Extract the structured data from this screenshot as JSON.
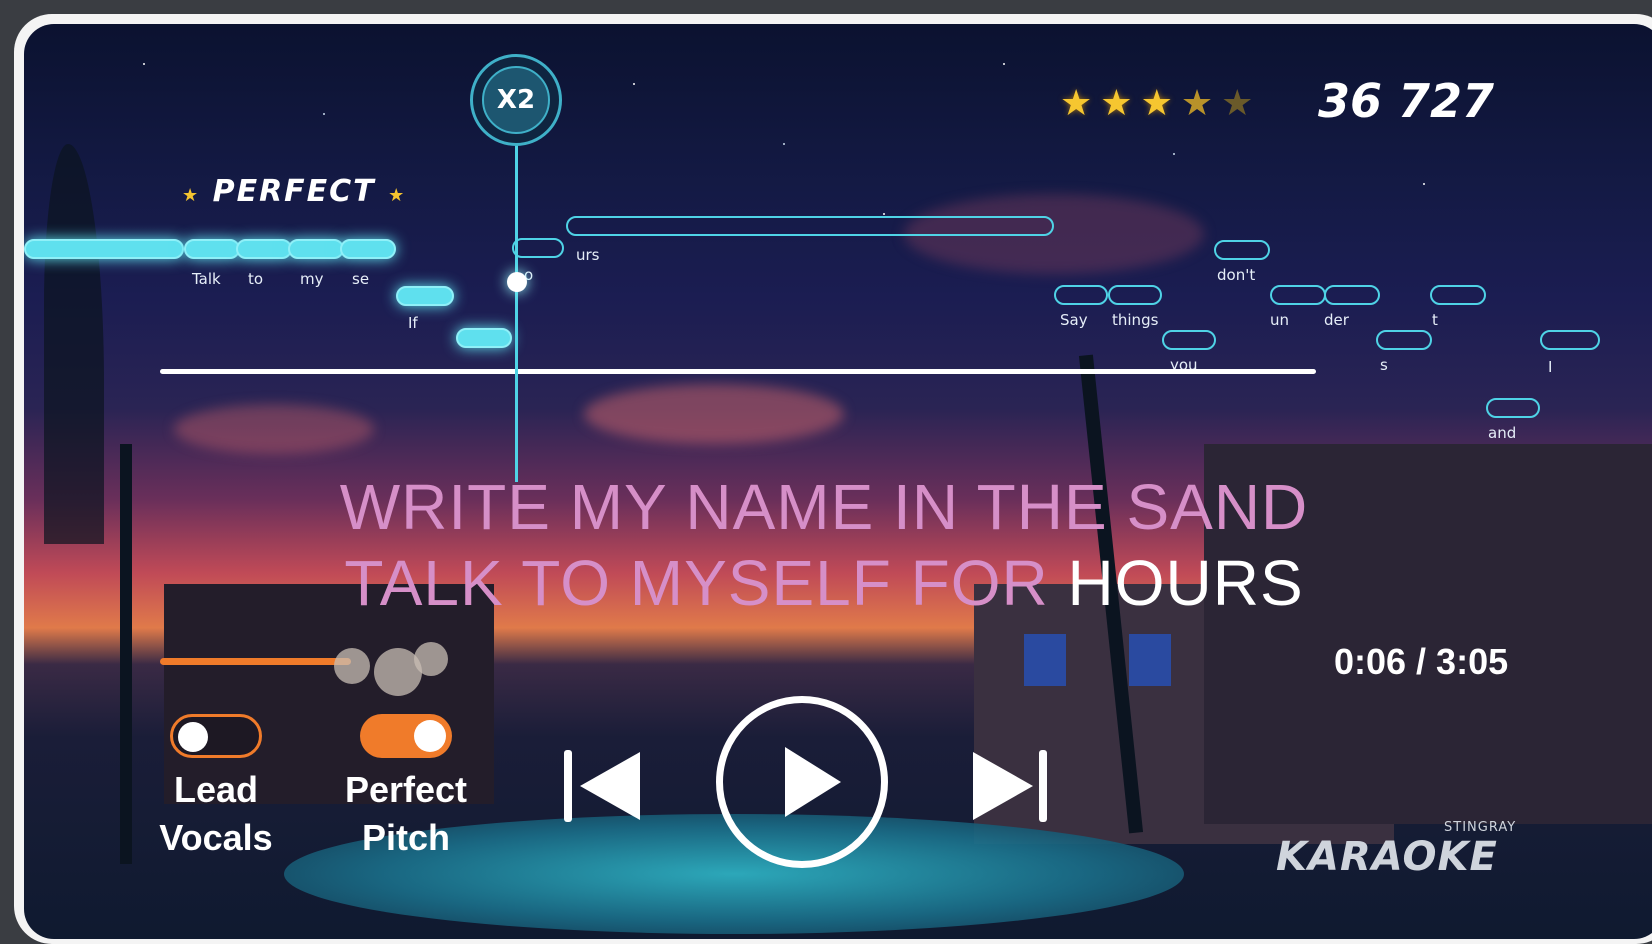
{
  "multiplier": "X2",
  "feedback": {
    "text": "PERFECT",
    "star_left": "★",
    "star_right": "★"
  },
  "rating": {
    "stars": 5,
    "value": 3.5,
    "glyph": "★"
  },
  "score": "36 727",
  "pitch_words": {
    "talk": "Talk",
    "to": "to",
    "my": "my",
    "se": "se",
    "if": "If",
    "o": "o",
    "urs": "urs",
    "dont": "don't",
    "say": "Say",
    "things": "things",
    "un": "un",
    "der": "der",
    "t": "t",
    "you": "you",
    "s": "s",
    "i": "I",
    "and": "and"
  },
  "lyrics": {
    "line1": "WRITE MY NAME IN THE SAND",
    "line2_sung": "TALK TO MYSELF FOR ",
    "line2_current": "HOURS"
  },
  "playback": {
    "time": "0:06 / 3:05",
    "progress_fraction": 0.033
  },
  "toggles": {
    "lead_vocals": {
      "label_line1": "Lead",
      "label_line2": "Vocals",
      "on": false
    },
    "perfect_pitch": {
      "label_line1": "Perfect",
      "label_line2": "Pitch",
      "on": true
    }
  },
  "controls": {
    "prev_icon": "skip-previous-icon",
    "play_icon": "play-icon",
    "next_icon": "skip-next-icon"
  },
  "brand": {
    "small": "STINGRAY",
    "big": "KARAOKE"
  },
  "colors": {
    "accent": "#f07b2a",
    "pitch": "#4fd3e6",
    "lyric_sung": "#d68fc8",
    "lyric_current": "#ffffff",
    "star": "#f6c630"
  }
}
